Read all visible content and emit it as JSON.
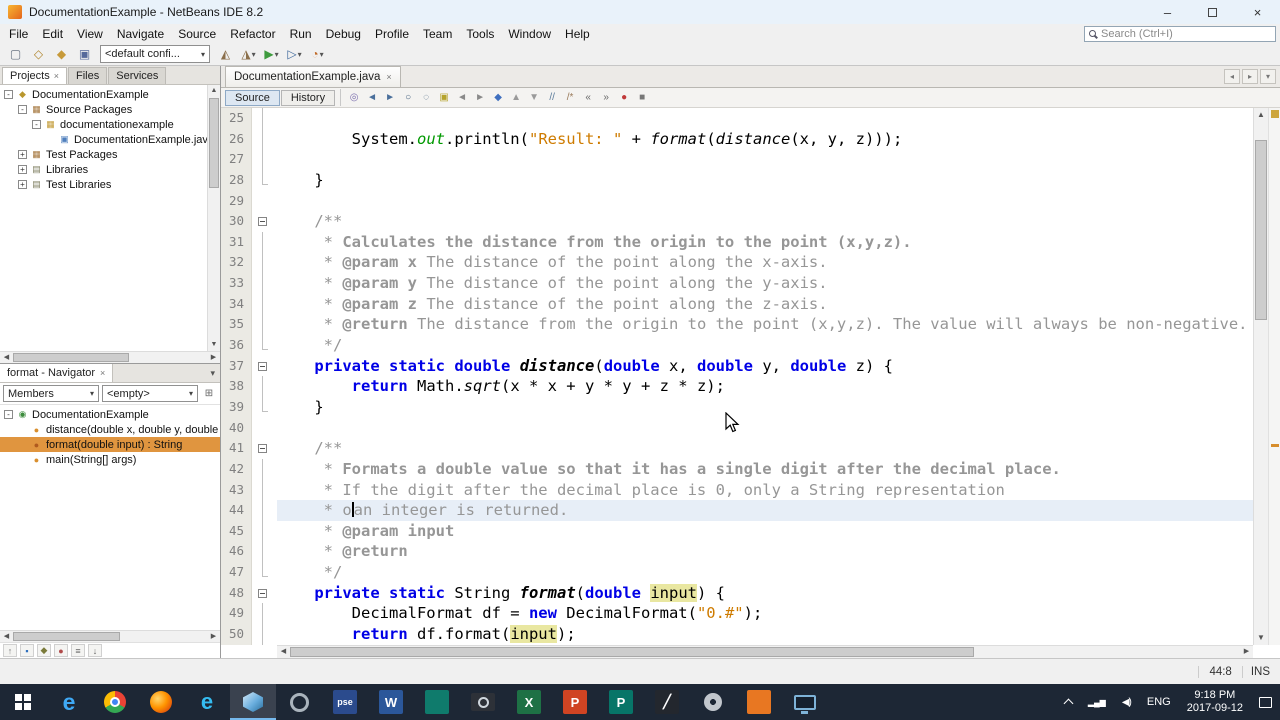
{
  "window": {
    "title": "DocumentationExample - NetBeans IDE 8.2"
  },
  "glyphs": {
    "chevron_down": "▾",
    "close": "×",
    "minimize": "–",
    "small_left": "◂",
    "small_right": "▸",
    "arrow_up": "▲",
    "arrow_down": "▼",
    "arrow_left": "◀",
    "arrow_right": "▶",
    "signal": "▂▄▆",
    "speaker": "◀)"
  },
  "menu": {
    "items": [
      "File",
      "Edit",
      "View",
      "Navigate",
      "Source",
      "Refactor",
      "Run",
      "Debug",
      "Profile",
      "Team",
      "Tools",
      "Window",
      "Help"
    ]
  },
  "search": {
    "placeholder": "Search (Ctrl+I)"
  },
  "toolbar": {
    "config_label": "<default confi...",
    "left_icons": [
      {
        "name": "new-file-icon",
        "glyph": "▢",
        "color": "#6b7685"
      },
      {
        "name": "new-project-icon",
        "glyph": "◇",
        "color": "#b0852c"
      },
      {
        "name": "open-project-icon",
        "glyph": "◆",
        "color": "#c79a3a"
      },
      {
        "name": "save-all-icon",
        "glyph": "▣",
        "color": "#56699b"
      }
    ],
    "right_icons": [
      {
        "name": "build-project-icon",
        "glyph": "◭",
        "color": "#8b6f4b"
      },
      {
        "name": "clean-build-icon",
        "glyph": "◮",
        "color": "#8b6f4b",
        "dd": true
      },
      {
        "name": "run-project-icon",
        "glyph": "▶",
        "color": "#3e9b3e",
        "dd": true
      },
      {
        "name": "debug-project-icon",
        "glyph": "▷",
        "color": "#3e689b",
        "dd": true
      },
      {
        "name": "profile-project-icon",
        "glyph": "◔",
        "color": "#c06a28",
        "dd": true
      }
    ]
  },
  "projects": {
    "tabs": [
      {
        "label": "Projects"
      },
      {
        "label": "Files"
      },
      {
        "label": "Services"
      }
    ],
    "tree": [
      {
        "depth": 0,
        "exp": "-",
        "glyph": "◆",
        "color": "#b9972e",
        "label": "DocumentationExample"
      },
      {
        "depth": 1,
        "exp": "-",
        "glyph": "▦",
        "color": "#a3743a",
        "label": "Source Packages"
      },
      {
        "depth": 2,
        "exp": "-",
        "glyph": "▦",
        "color": "#c29a35",
        "label": "documentationexample"
      },
      {
        "depth": 3,
        "glyph": "▣",
        "color": "#4f7fbd",
        "label": "DocumentationExample.java"
      },
      {
        "depth": 1,
        "exp": "+",
        "glyph": "▦",
        "color": "#a3743a",
        "label": "Test Packages"
      },
      {
        "depth": 1,
        "exp": "+",
        "glyph": "▤",
        "color": "#7d7d5f",
        "label": "Libraries"
      },
      {
        "depth": 1,
        "exp": "+",
        "glyph": "▤",
        "color": "#7d7d5f",
        "label": "Test Libraries"
      }
    ]
  },
  "navigator": {
    "title": "format - Navigator",
    "filters": {
      "members": "Members",
      "empty": "<empty>"
    },
    "tree": [
      {
        "depth": 0,
        "exp": "-",
        "glyph": "◉",
        "color": "#3d8c3d",
        "label": "DocumentationExample"
      },
      {
        "depth": 1,
        "glyph": "●",
        "color": "#d98f2e",
        "label": "distance(double x, double y, double z)"
      },
      {
        "depth": 1,
        "glyph": "●",
        "color": "#b05a1e",
        "label": "format(double input) : String",
        "selected": true
      },
      {
        "depth": 1,
        "glyph": "●",
        "color": "#d98f2e",
        "label": "main(String[] args)"
      }
    ],
    "filter_icons": [
      {
        "name": "show-inherited-icon",
        "glyph": "↑",
        "color": "#7a7a7a"
      },
      {
        "name": "show-fields-icon",
        "glyph": "▪",
        "color": "#2e6fbd"
      },
      {
        "name": "show-static-members-icon",
        "glyph": "◆",
        "color": "#7a7a3a"
      },
      {
        "name": "show-non-public-icon",
        "glyph": "●",
        "color": "#b04a4a"
      },
      {
        "name": "sort-alphabetically-icon",
        "glyph": "≡",
        "color": "#666666"
      },
      {
        "name": "sort-by-source-icon",
        "glyph": "↓",
        "color": "#666666"
      }
    ]
  },
  "editor": {
    "tab": {
      "label": "DocumentationExample.java"
    },
    "views": [
      {
        "label": "Source"
      },
      {
        "label": "History"
      }
    ],
    "tool_icons": [
      {
        "name": "last-edit-icon",
        "glyph": "◎",
        "color": "#7c6fae"
      },
      {
        "name": "back-icon",
        "glyph": "◄",
        "color": "#4a6f9b"
      },
      {
        "name": "forward-icon",
        "glyph": "►",
        "color": "#4a6f9b"
      },
      {
        "name": "find-selection-icon",
        "glyph": "○",
        "color": "#44617e"
      },
      {
        "name": "find-occurrences-icon",
        "glyph": "◌",
        "color": "#44617e"
      },
      {
        "name": "toggle-highlight-icon",
        "glyph": "▣",
        "color": "#b5a32c"
      },
      {
        "name": "previous-bookmark-icon",
        "glyph": "◄",
        "color": "#8a8a8a"
      },
      {
        "name": "next-bookmark-icon",
        "glyph": "►",
        "color": "#8a8a8a"
      },
      {
        "name": "toggle-bookmark-icon",
        "glyph": "◆",
        "color": "#3f6fbf"
      },
      {
        "name": "previous-occurrence-icon",
        "glyph": "▲",
        "color": "#9a9a9a"
      },
      {
        "name": "next-occurrence-icon",
        "glyph": "▼",
        "color": "#9a9a9a"
      },
      {
        "name": "comment-icon",
        "glyph": "//",
        "color": "#5a7a9a"
      },
      {
        "name": "uncomment-icon",
        "glyph": "/*",
        "color": "#9a7a5a"
      },
      {
        "name": "shift-left-icon",
        "glyph": "«",
        "color": "#666666"
      },
      {
        "name": "shift-right-icon",
        "glyph": "»",
        "color": "#666666"
      },
      {
        "name": "start-macro-icon",
        "glyph": "●",
        "color": "#c03a3a"
      },
      {
        "name": "stop-macro-icon",
        "glyph": "■",
        "color": "#777777"
      }
    ],
    "lines": [
      {
        "n": 25,
        "fold": "mid",
        "seg": []
      },
      {
        "n": 26,
        "fold": "mid",
        "seg": [
          {
            "t": "        System.",
            "c": "pl"
          },
          {
            "t": "out",
            "c": "sf"
          },
          {
            "t": ".println(",
            "c": "pl"
          },
          {
            "t": "\"Result: \"",
            "c": "str"
          },
          {
            "t": " + ",
            "c": "pl"
          },
          {
            "t": "format",
            "c": "sm"
          },
          {
            "t": "(",
            "c": "pl"
          },
          {
            "t": "distance",
            "c": "sm"
          },
          {
            "t": "(x, y, z)));",
            "c": "pl"
          }
        ]
      },
      {
        "n": 27,
        "fold": "mid",
        "seg": []
      },
      {
        "n": 28,
        "fold": "end",
        "seg": [
          {
            "t": "    }",
            "c": "pl"
          }
        ]
      },
      {
        "n": 29,
        "seg": []
      },
      {
        "n": 30,
        "fold": "start",
        "seg": [
          {
            "t": "    ",
            "c": "pl"
          },
          {
            "t": "/**",
            "c": "cm"
          }
        ]
      },
      {
        "n": 31,
        "fold": "mid",
        "seg": [
          {
            "t": "     * ",
            "c": "cm"
          },
          {
            "t": "Calculates the distance from the origin to the point (x,y,z).",
            "c": "cmb"
          }
        ]
      },
      {
        "n": 32,
        "fold": "mid",
        "seg": [
          {
            "t": "     * ",
            "c": "cm"
          },
          {
            "t": "@param x",
            "c": "cmb"
          },
          {
            "t": " The distance of the point along the x-axis.",
            "c": "cm"
          }
        ]
      },
      {
        "n": 33,
        "fold": "mid",
        "seg": [
          {
            "t": "     * ",
            "c": "cm"
          },
          {
            "t": "@param y",
            "c": "cmb"
          },
          {
            "t": " The distance of the point along the y-axis.",
            "c": "cm"
          }
        ]
      },
      {
        "n": 34,
        "fold": "mid",
        "seg": [
          {
            "t": "     * ",
            "c": "cm"
          },
          {
            "t": "@param z",
            "c": "cmb"
          },
          {
            "t": " The distance of the point along the z-axis.",
            "c": "cm"
          }
        ]
      },
      {
        "n": 35,
        "fold": "mid",
        "seg": [
          {
            "t": "     * ",
            "c": "cm"
          },
          {
            "t": "@return",
            "c": "cmb"
          },
          {
            "t": " The distance from the origin to the point (x,y,z). The value will always be non-negative.",
            "c": "cm"
          }
        ]
      },
      {
        "n": 36,
        "fold": "end",
        "seg": [
          {
            "t": "     */",
            "c": "cm"
          }
        ]
      },
      {
        "n": 37,
        "fold": "start",
        "seg": [
          {
            "t": "    ",
            "c": "pl"
          },
          {
            "t": "private",
            "c": "kw"
          },
          {
            "t": " ",
            "c": "pl"
          },
          {
            "t": "static",
            "c": "kw"
          },
          {
            "t": " ",
            "c": "pl"
          },
          {
            "t": "double",
            "c": "kw"
          },
          {
            "t": " ",
            "c": "pl"
          },
          {
            "t": "distance",
            "c": "md"
          },
          {
            "t": "(",
            "c": "pl"
          },
          {
            "t": "double",
            "c": "kw"
          },
          {
            "t": " x, ",
            "c": "pl"
          },
          {
            "t": "double",
            "c": "kw"
          },
          {
            "t": " y, ",
            "c": "pl"
          },
          {
            "t": "double",
            "c": "kw"
          },
          {
            "t": " z) {",
            "c": "pl"
          }
        ]
      },
      {
        "n": 38,
        "fold": "mid",
        "seg": [
          {
            "t": "        ",
            "c": "pl"
          },
          {
            "t": "return",
            "c": "kw"
          },
          {
            "t": " Math.",
            "c": "pl"
          },
          {
            "t": "sqrt",
            "c": "sm"
          },
          {
            "t": "(x * x + y * y + z * z);",
            "c": "pl"
          }
        ]
      },
      {
        "n": 39,
        "fold": "end",
        "seg": [
          {
            "t": "    }",
            "c": "pl"
          }
        ]
      },
      {
        "n": 40,
        "seg": []
      },
      {
        "n": 41,
        "fold": "start",
        "seg": [
          {
            "t": "    ",
            "c": "pl"
          },
          {
            "t": "/**",
            "c": "cm"
          }
        ]
      },
      {
        "n": 42,
        "fold": "mid",
        "seg": [
          {
            "t": "     * ",
            "c": "cm"
          },
          {
            "t": "Formats a double value so that it has a single digit after the decimal place.",
            "c": "cmb"
          }
        ]
      },
      {
        "n": 43,
        "fold": "mid",
        "seg": [
          {
            "t": "     * If the digit after the decimal place is 0, only a String representation",
            "c": "cm"
          }
        ]
      },
      {
        "n": 44,
        "fold": "mid",
        "current": true,
        "seg": [
          {
            "t": "     * o",
            "c": "cm"
          },
          {
            "caret": true
          },
          {
            "t": "an integer is returned.",
            "c": "cm"
          }
        ]
      },
      {
        "n": 45,
        "fold": "mid",
        "seg": [
          {
            "t": "     * ",
            "c": "cm"
          },
          {
            "t": "@param input",
            "c": "cmb"
          }
        ]
      },
      {
        "n": 46,
        "fold": "mid",
        "seg": [
          {
            "t": "     * ",
            "c": "cm"
          },
          {
            "t": "@return",
            "c": "cmb"
          }
        ]
      },
      {
        "n": 47,
        "fold": "end",
        "seg": [
          {
            "t": "     */",
            "c": "cm"
          }
        ]
      },
      {
        "n": 48,
        "fold": "start",
        "seg": [
          {
            "t": "    ",
            "c": "pl"
          },
          {
            "t": "private",
            "c": "kw"
          },
          {
            "t": " ",
            "c": "pl"
          },
          {
            "t": "static",
            "c": "kw"
          },
          {
            "t": " String ",
            "c": "pl"
          },
          {
            "t": "format",
            "c": "md"
          },
          {
            "t": "(",
            "c": "pl"
          },
          {
            "t": "double",
            "c": "kw"
          },
          {
            "t": " ",
            "c": "pl"
          },
          {
            "t": "input",
            "c": "hl"
          },
          {
            "t": ") {",
            "c": "pl"
          }
        ]
      },
      {
        "n": 49,
        "fold": "mid",
        "seg": [
          {
            "t": "        DecimalFormat df = ",
            "c": "pl"
          },
          {
            "t": "new",
            "c": "kw"
          },
          {
            "t": " DecimalFormat(",
            "c": "pl"
          },
          {
            "t": "\"0.#\"",
            "c": "str"
          },
          {
            "t": ");",
            "c": "pl"
          }
        ]
      },
      {
        "n": 50,
        "fold": "mid",
        "seg": [
          {
            "t": "        ",
            "c": "pl"
          },
          {
            "t": "return",
            "c": "kw"
          },
          {
            "t": " df.format(",
            "c": "pl"
          },
          {
            "t": "input",
            "c": "hl"
          },
          {
            "t": ");",
            "c": "pl"
          }
        ]
      }
    ]
  },
  "status": {
    "caret_pos": "44:8",
    "mode": "INS"
  },
  "taskbar": {
    "apps": [
      {
        "name": "edge-icon",
        "kind": "edge"
      },
      {
        "name": "chrome-icon",
        "kind": "chrome"
      },
      {
        "name": "firefox-icon",
        "kind": "firefox"
      },
      {
        "name": "browser-icon",
        "kind": "ie"
      },
      {
        "name": "netbeans-icon",
        "kind": "netbeans",
        "active": true
      },
      {
        "name": "app-circle-icon",
        "kind": "ring"
      },
      {
        "name": "pse-app-icon",
        "kind": "tile",
        "label": "pse",
        "bg": "#2b4b8d",
        "fs": 9
      },
      {
        "name": "word-icon",
        "kind": "tile",
        "label": "W",
        "bg": "#2b579a"
      },
      {
        "name": "teal-app-icon",
        "kind": "tile",
        "label": "",
        "bg": "#0f7b6c"
      },
      {
        "name": "snipping-tool-icon",
        "kind": "camera"
      },
      {
        "name": "excel-icon",
        "kind": "tile",
        "label": "X",
        "bg": "#1e7145"
      },
      {
        "name": "powerpoint-icon",
        "kind": "tile",
        "label": "P",
        "bg": "#d04423"
      },
      {
        "name": "publisher-icon",
        "kind": "tile",
        "label": "P",
        "bg": "#077568"
      },
      {
        "name": "pen-app-icon",
        "kind": "tile",
        "label": "╱",
        "bg": "#23272e"
      },
      {
        "name": "settings-gear-icon",
        "kind": "gear"
      },
      {
        "name": "media-app-icon",
        "kind": "tile",
        "label": "",
        "bg": "#e87722"
      },
      {
        "name": "display-app-icon",
        "kind": "monitor"
      }
    ],
    "tray": {
      "lang": "ENG",
      "time": "9:18 PM",
      "date": "2017-09-12"
    }
  }
}
